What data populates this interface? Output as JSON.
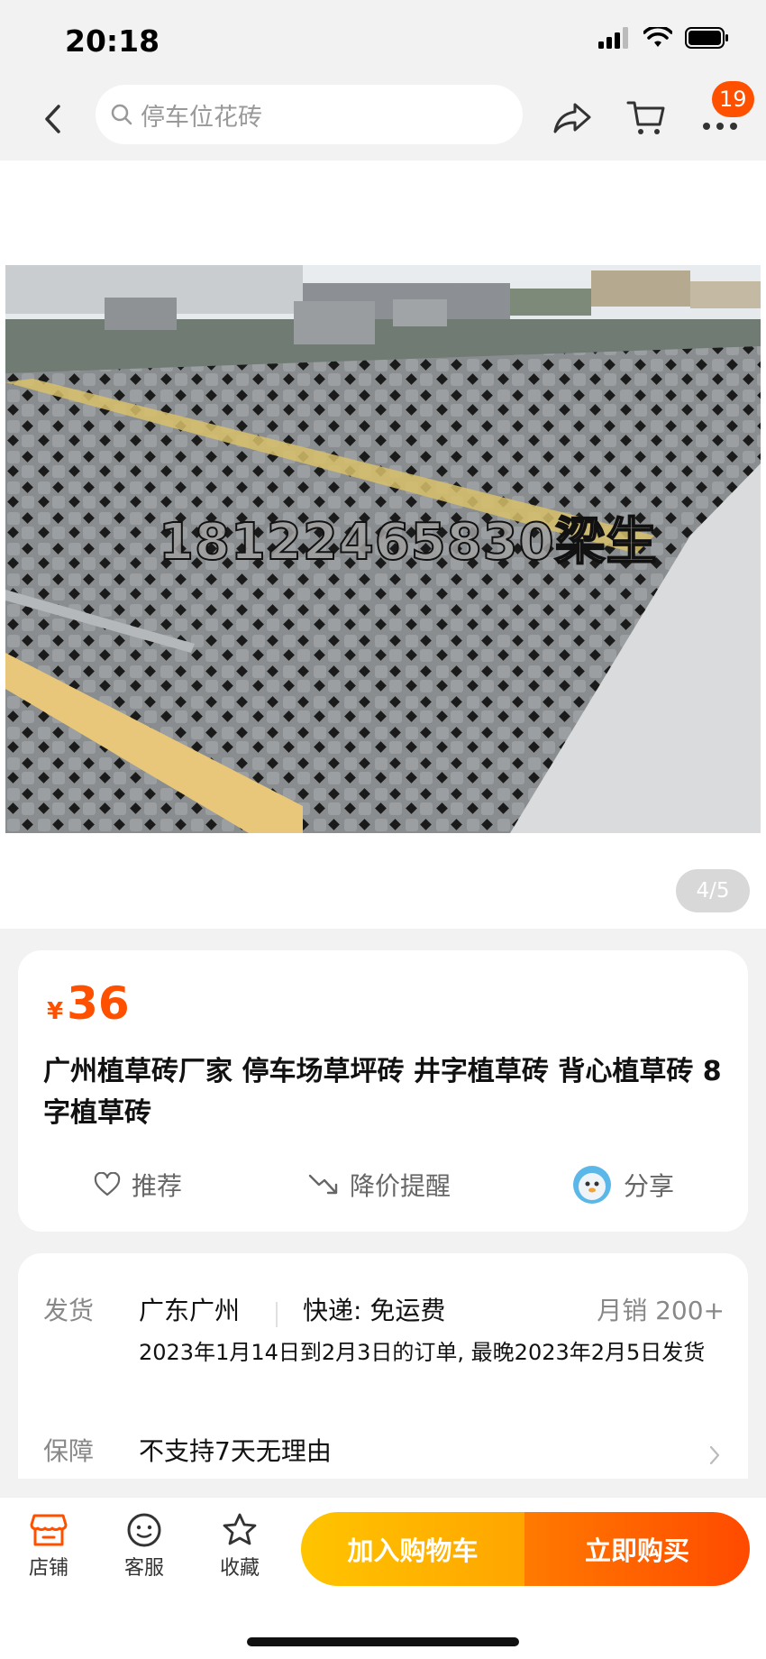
{
  "status_bar": {
    "time": "20:18"
  },
  "nav": {
    "search_placeholder": "停车位花砖",
    "cart_badge": "19"
  },
  "gallery": {
    "watermark": "18122465830梁生",
    "page_indicator": "4/5"
  },
  "product": {
    "currency": "¥",
    "price": "36",
    "title": "广州植草砖厂家 停车场草坪砖 井字植草砖 背心植草砖 8字植草砖",
    "actions": {
      "recommend": "推荐",
      "price_alert": "降价提醒",
      "share": "分享"
    }
  },
  "shipping": {
    "ship_label": "发货",
    "origin": "广东广州",
    "express": "快递: 免运费",
    "monthly_sales": "月销  200+",
    "note": "2023年1月14日到2月3日的订单, 最晚2023年2月5日发货",
    "guarantee_label": "保障",
    "guarantee": "不支持7天无理由"
  },
  "bottom_bar": {
    "shop": "店铺",
    "service": "客服",
    "favorite": "收藏",
    "add_to_cart": "加入购物车",
    "buy_now": "立即购买"
  },
  "colors": {
    "accent": "#ff5000",
    "cart_button": "#ffb300",
    "buy_button": "#ff5a00"
  }
}
